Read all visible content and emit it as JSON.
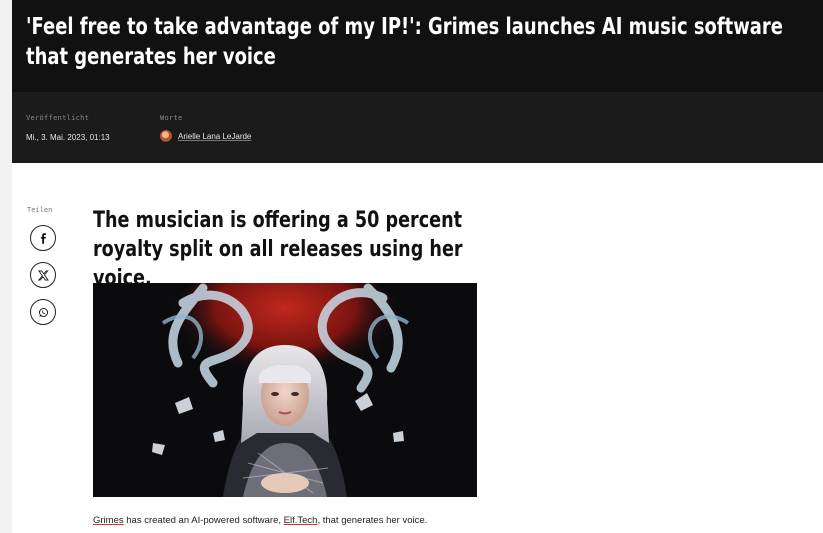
{
  "article": {
    "headline": "'Feel free to take advantage of my IP!': Grimes launches AI music software that generates her voice",
    "meta": {
      "published_label": "Veröffentlicht",
      "published_value": "Mi., 3. Mai. 2023, 01:13",
      "words_label": "Worte",
      "author": "Arielle Lana LeJarde"
    },
    "share": {
      "label": "Teilen",
      "buttons": [
        "facebook-icon",
        "x-icon",
        "whatsapp-icon"
      ]
    },
    "subheadline": "The musician is offering a 50 percent royalty split on all releases using her voice.",
    "caption": {
      "link1": "Grimes",
      "text1": " has created an AI-powered software, ",
      "link2": "Elf.Tech",
      "text2": ", that generates her voice."
    }
  },
  "colors": {
    "headline_bg": "#111111",
    "meta_bg": "#1b1b1b",
    "link_underline": "#cc3333"
  }
}
